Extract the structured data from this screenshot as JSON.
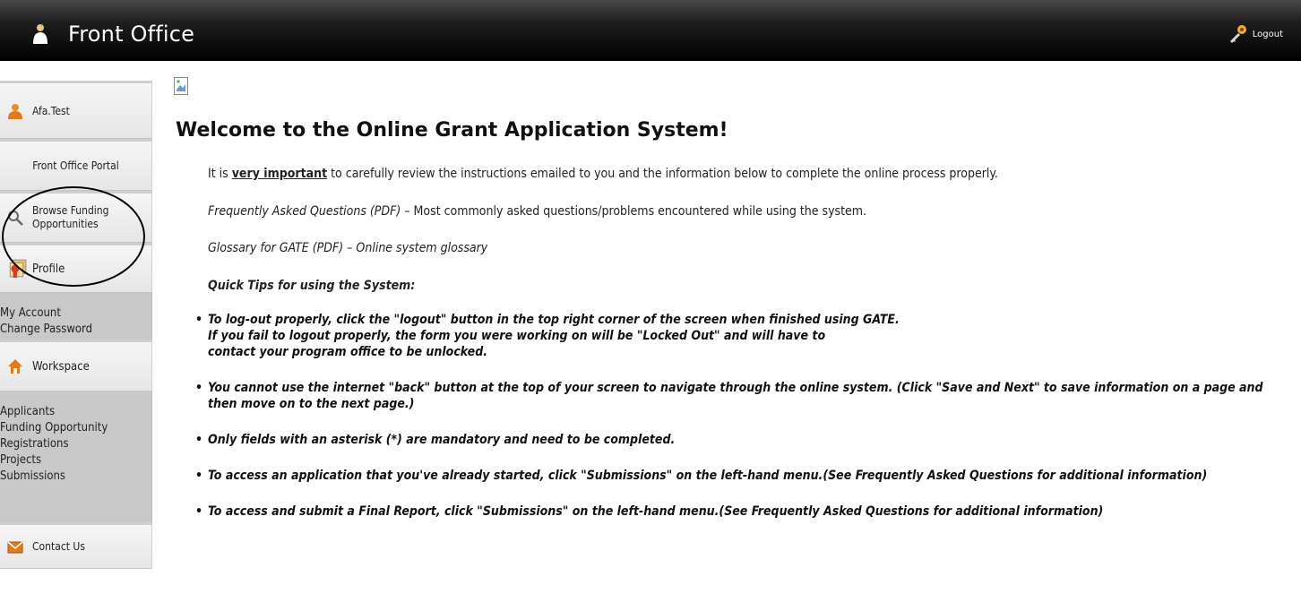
{
  "header": {
    "title": "Front Office",
    "logout_label": "Logout"
  },
  "sidebar": {
    "user": "Afa.Test",
    "portal": "Front Office Portal",
    "browse": "Browse Funding Opportunities",
    "browse_line1": "Browse Funding",
    "browse_line2": "Opportunities",
    "profile": "Profile",
    "account_links": [
      "My Account",
      "Change Password"
    ],
    "workspace": "Workspace",
    "workspace_links": [
      "Applicants",
      "Funding Opportunity",
      "Registrations",
      "Projects",
      "Submissions"
    ],
    "contact": "Contact Us"
  },
  "main": {
    "title": "Welcome to the Online Grant Application System!",
    "intro_pre": "It is ",
    "intro_emph": "very important",
    "intro_post": " to carefully review the instructions emailed to you and the information below to complete the online process properly.",
    "faq_link": "Frequently Asked Questions (PDF)",
    "faq_desc": " – Most commonly asked questions/problems encountered while using the system.",
    "glossary_link": "Glossary for GATE (PDF)",
    "glossary_desc": " – Online system glossary",
    "tips_title": "Quick Tips for using the System:",
    "tips": [
      [
        "To log-out properly, click the \"logout\" button in the top right corner of the screen when finished using GATE.",
        "If you fail to logout properly, the form you were working on will be \"Locked Out\" and will have to",
        "contact your program office to be unlocked."
      ],
      [
        "You cannot use the internet \"back\" button at the top of your screen to navigate through the online system. (Click \"Save and Next\" to save information on a page and",
        "then move on to the next page.)"
      ],
      [
        "Only fields with an asterisk (*) are mandatory and need to be completed."
      ],
      [
        "To access an application that you've already started, click \"Submissions\" on the left-hand menu.(See Frequently Asked Questions for additional information)"
      ],
      [
        "To access and submit a Final Report, click \"Submissions\" on the left-hand menu.(See Frequently Asked Questions for additional information)"
      ]
    ]
  },
  "icons": {
    "brand": "person-icon",
    "logout": "key-icon",
    "user": "user-icon",
    "browse": "magnifier-icon",
    "profile": "profile-icon",
    "workspace": "home-icon",
    "contact": "envelope-icon"
  },
  "colors": {
    "topbar": "#000000",
    "sidebar_card": "#eeeeee",
    "sidebar_sub": "#c9c9c9",
    "text": "#111111"
  }
}
